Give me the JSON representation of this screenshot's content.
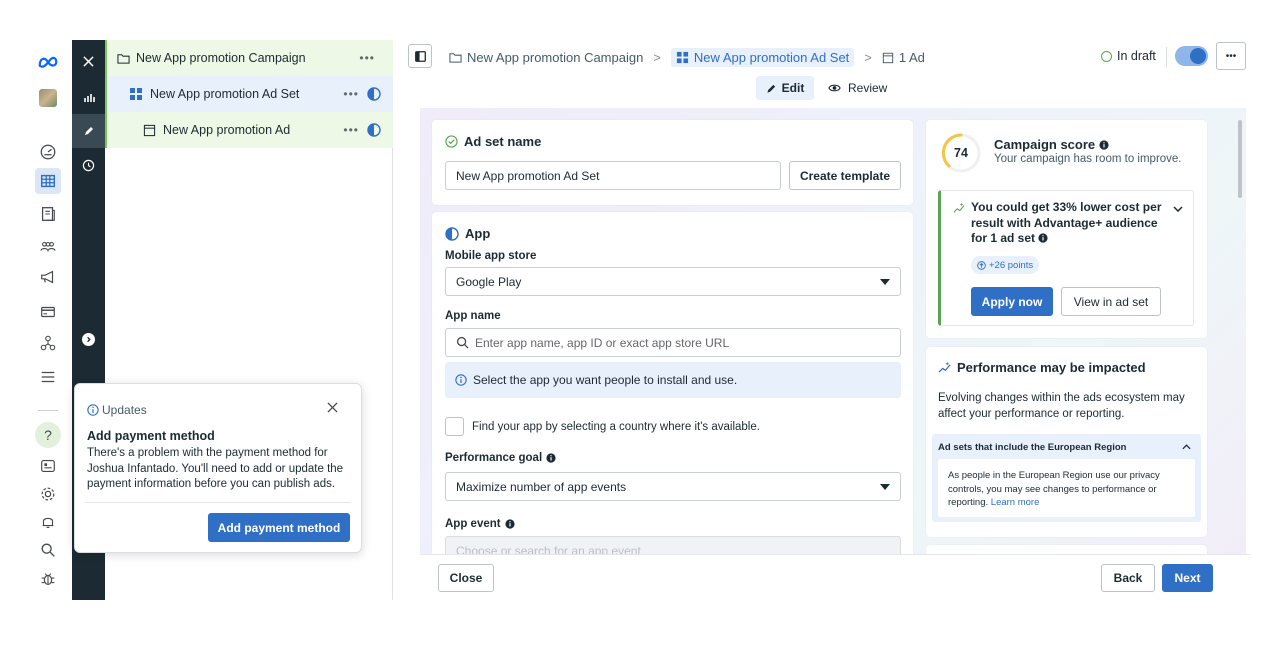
{
  "tree": {
    "campaign": "New App promotion Campaign",
    "adset": "New App promotion Ad Set",
    "ad": "New App promotion Ad",
    "more": "•••"
  },
  "breadcrumb": {
    "campaign": "New App promotion Campaign",
    "adset": "New App promotion Ad Set",
    "ad": "1 Ad",
    "sep": ">"
  },
  "status": {
    "label": "In draft"
  },
  "more_label": "•••",
  "modes": {
    "edit": "Edit",
    "review": "Review"
  },
  "adset_card": {
    "title": "Ad set name",
    "name_value": "New App promotion Ad Set",
    "create_template": "Create template"
  },
  "app_card": {
    "title": "App",
    "store_label": "Mobile app store",
    "store_value": "Google Play",
    "app_name_label": "App name",
    "app_name_placeholder": "Enter app name, app ID or exact app store URL",
    "info_text": "Select the app you want people to install and use.",
    "country_checkbox": "Find your app by selecting a country where it's available.",
    "perf_goal_label": "Performance goal",
    "perf_goal_value": "Maximize number of app events",
    "app_event_label": "App event",
    "app_event_placeholder": "Choose or search for an app event"
  },
  "score_card": {
    "score": "74",
    "title": "Campaign score",
    "subtitle": "Your campaign has room to improve.",
    "tip": "You could get 33% lower cost per result with Advantage+ audience for 1 ad set",
    "points": "+26 points",
    "apply": "Apply now",
    "view": "View in ad set"
  },
  "perf_card": {
    "title": "Performance may be impacted",
    "body": "Evolving changes within the ads ecosystem may affect your performance or reporting.",
    "eu_title": "Ad sets that include the European Region",
    "eu_body": "As people in the European Region use our privacy controls, you may see changes to performance or reporting.",
    "learn_more": "Learn more"
  },
  "popup": {
    "header": "Updates",
    "title": "Add payment method",
    "body": "There's a problem with the payment method for Joshua Infantado. You'll need to add or update the payment information before you can publish ads.",
    "button": "Add payment method"
  },
  "footer": {
    "close": "Close",
    "back": "Back",
    "next": "Next"
  },
  "colors": {
    "accent": "#2f6fc6",
    "rail_selected": "#dbe7f6",
    "tree_campaign_bg": "#eef8e6",
    "tree_adset_bg": "#e7f0fb",
    "dark_strip": "#1c2b33"
  }
}
